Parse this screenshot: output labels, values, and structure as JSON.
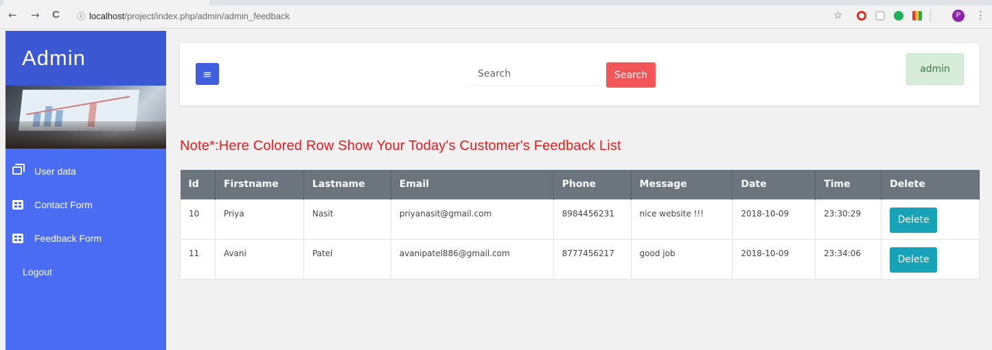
{
  "browser": {
    "url_host": "localhost",
    "url_path": "/project/index.php/admin/admin_feedback",
    "back_icon": "←",
    "forward_icon": "→",
    "reload_icon": "C",
    "info_icon": "ⓘ",
    "star_icon": "☆",
    "menu_icon": "⋮",
    "profile_initial": "P"
  },
  "sidebar": {
    "title": "Admin",
    "items": [
      {
        "label": "User data",
        "icon": "window-icon"
      },
      {
        "label": "Contact Form",
        "icon": "table-icon"
      },
      {
        "label": "Feedback Form",
        "icon": "table-icon"
      },
      {
        "label": "Logout",
        "icon": ""
      }
    ]
  },
  "header": {
    "menu_icon": "≡",
    "search_placeholder": "Search",
    "search_button": "Search",
    "user_label": "admin"
  },
  "note": "Note*:Here Colored Row Show Your Today's Customer's Feedback List",
  "table": {
    "columns": [
      "Id",
      "Firstname",
      "Lastname",
      "Email",
      "Phone",
      "Message",
      "Date",
      "Time",
      "Delete"
    ],
    "rows": [
      {
        "id": "10",
        "firstname": "Priya",
        "lastname": "Nasit",
        "email": "priyanasit@gmail.com",
        "phone": "8984456231",
        "message": "nice website !!!",
        "date": "2018-10-09",
        "time": "23:30:29",
        "delete": "Delete"
      },
      {
        "id": "11",
        "firstname": "Avani",
        "lastname": "Patel",
        "email": "avanipatel886@gmail.com",
        "phone": "8777456217",
        "message": "good job",
        "date": "2018-10-09",
        "time": "23:34:06",
        "delete": "Delete"
      }
    ]
  },
  "colors": {
    "sidebar": "#4a6cf3",
    "sidebar_header": "#3c57d2",
    "search_button": "#f25656",
    "delete_button": "#17a2b8",
    "table_header": "#6c757d",
    "note_text": "#e81a1a"
  }
}
